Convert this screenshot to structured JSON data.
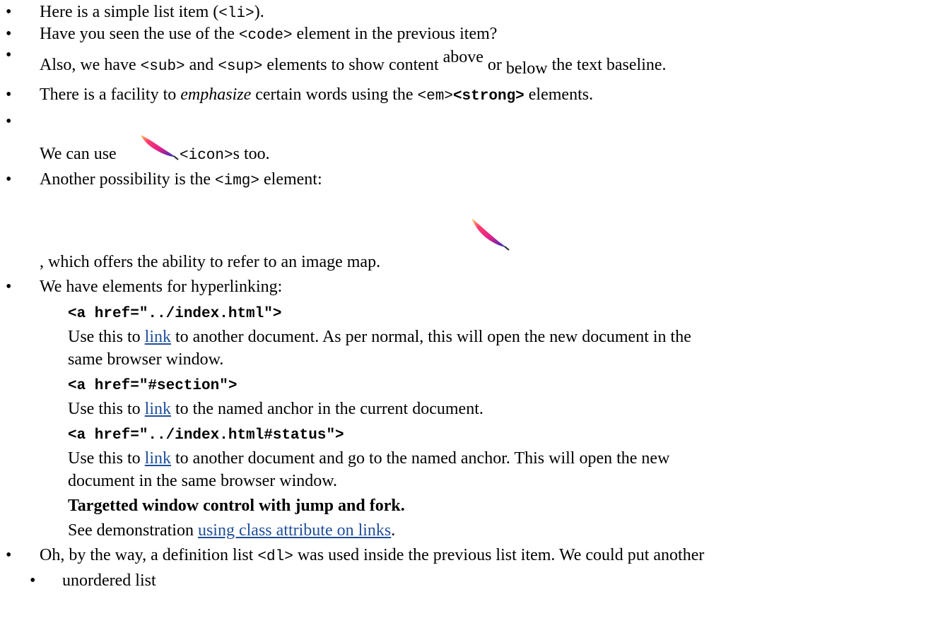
{
  "items": {
    "li1": {
      "before": "Here is a simple list item (",
      "code": "<li>",
      "after": ")."
    },
    "li2": {
      "before": "Have you seen the use of the ",
      "code": "<code>",
      "after": " element in the previous item?"
    },
    "li3": {
      "part1": "Also, we have ",
      "code_sub": "<sub>",
      "part2": " and ",
      "code_sup": "<sup>",
      "part3": " elements to show content ",
      "sup_text": "above",
      "part4": " or ",
      "sub_text": "below",
      "part5": " the text baseline."
    },
    "li4": {
      "before": "There is a facility to ",
      "em_text": "emphasize",
      "middle": " certain words using the ",
      "code_em": "<em>",
      "code_strong": "<strong>",
      "after": " elements."
    },
    "li5": {
      "before": "We can use ",
      "code": "<icon>",
      "after": "s too."
    },
    "li6": {
      "before": "Another possibility is the ",
      "code": "<img>",
      "after": " element:",
      "continuation": ", which offers the ability to refer to an image map."
    },
    "li7": {
      "intro": "We have elements for hyperlinking:",
      "definitions": [
        {
          "term": "<a href=\"../index.html\">",
          "line1_before": "Use this to ",
          "line1_link": "link",
          "line1_after": " to another document. As per normal, this will open the new document in the",
          "line2": "same browser window."
        },
        {
          "term": "<a href=\"#section\">",
          "line1_before": "Use this to ",
          "line1_link": "link",
          "line1_after": " to the named anchor in the current document."
        },
        {
          "term": "<a href=\"../index.html#status\">",
          "line1_before": "Use this to ",
          "line1_link": "link",
          "line1_after": " to another document and go to the named anchor. This will open the new",
          "line2": "document in the same browser window."
        },
        {
          "term": "Targetted window control with jump and fork.",
          "line1_before": "See demonstration ",
          "line1_link": "using class attribute on links",
          "line1_after": "."
        }
      ]
    },
    "li8": {
      "before": "Oh, by the way, a definition list ",
      "code": "<dl>",
      "after": " was used inside the previous list item. We could put another"
    },
    "nested": {
      "item1": "unordered list"
    }
  },
  "bullet_char": "•",
  "link_color": "#1f4e99",
  "icon": "feather-icon"
}
